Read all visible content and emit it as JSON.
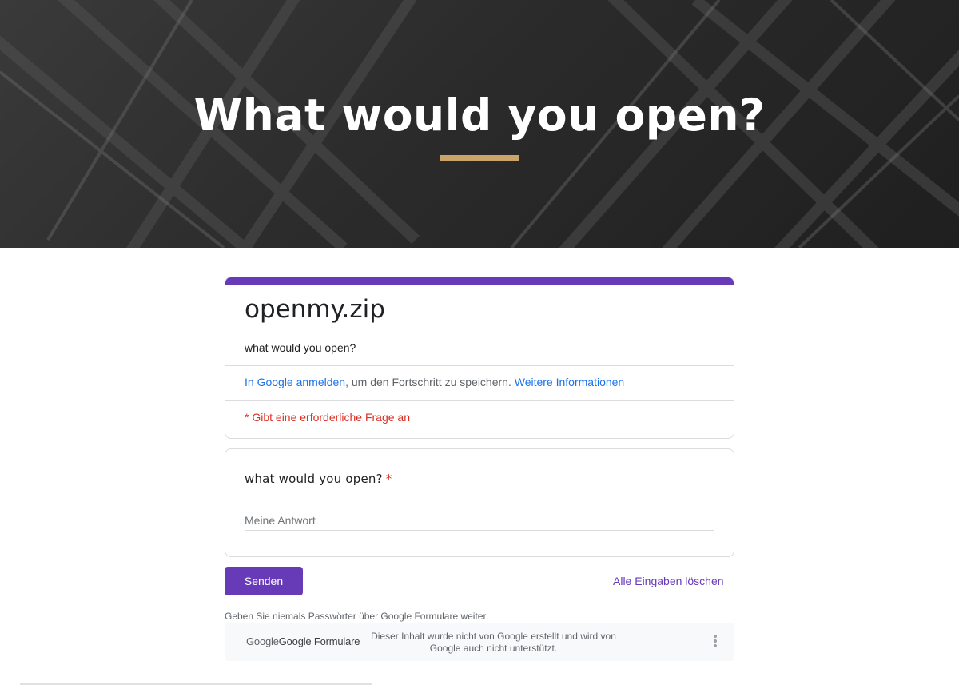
{
  "hero": {
    "title": "What would you open?",
    "accent_color": "#c9a56a"
  },
  "form": {
    "title": "openmy.zip",
    "description": "what would you open?",
    "theme_color": "#673ab7",
    "signin": {
      "link_text": "In Google anmelden",
      "middle_text": ", um den Fortschritt zu speichern. ",
      "more_link": "Weitere Informationen"
    },
    "required_note": "* Gibt eine erforderliche Frage an"
  },
  "question": {
    "label": "what would you open?",
    "required_mark": "*",
    "placeholder": "Meine Antwort",
    "value": ""
  },
  "actions": {
    "submit_label": "Senden",
    "clear_label": "Alle Eingaben löschen"
  },
  "footer": {
    "password_warning": "Geben Sie niemals Passwörter über Google Formulare weiter.",
    "logo_google": "Google",
    "logo_product": "Google Formulare",
    "disclaimer": "Dieser Inhalt wurde nicht von Google erstellt und wird von Google auch nicht unterstützt.",
    "more_icon": "more-vert-icon"
  }
}
